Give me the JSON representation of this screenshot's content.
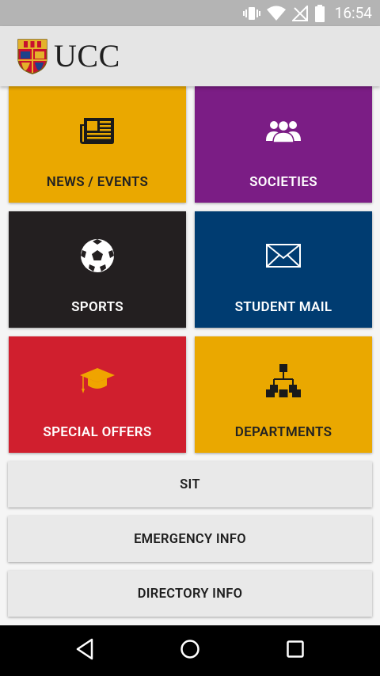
{
  "status_bar": {
    "time": "16:54",
    "icons": [
      "vibrate-icon",
      "wifi-icon",
      "no-signal-icon",
      "battery-icon"
    ]
  },
  "app_bar": {
    "logo_text": "UCC"
  },
  "tiles": [
    {
      "label": "NEWS / EVENTS",
      "icon": "newspaper-icon",
      "color": "#eaa800"
    },
    {
      "label": "SOCIETIES",
      "icon": "group-icon",
      "color": "#7b1d85"
    },
    {
      "label": "SPORTS",
      "icon": "soccer-ball-icon",
      "color": "#231f20"
    },
    {
      "label": "STUDENT MAIL",
      "icon": "envelope-icon",
      "color": "#003c71"
    },
    {
      "label": "SPECIAL OFFERS",
      "icon": "graduation-cap-icon",
      "color": "#d01f2e"
    },
    {
      "label": "DEPARTMENTS",
      "icon": "org-chart-icon",
      "color": "#eaa800"
    }
  ],
  "buttons": [
    {
      "label": "SIT"
    },
    {
      "label": "EMERGENCY INFO"
    },
    {
      "label": "DIRECTORY INFO"
    }
  ],
  "nav_bar": {
    "icons": [
      "back-icon",
      "home-icon",
      "recents-icon"
    ]
  }
}
